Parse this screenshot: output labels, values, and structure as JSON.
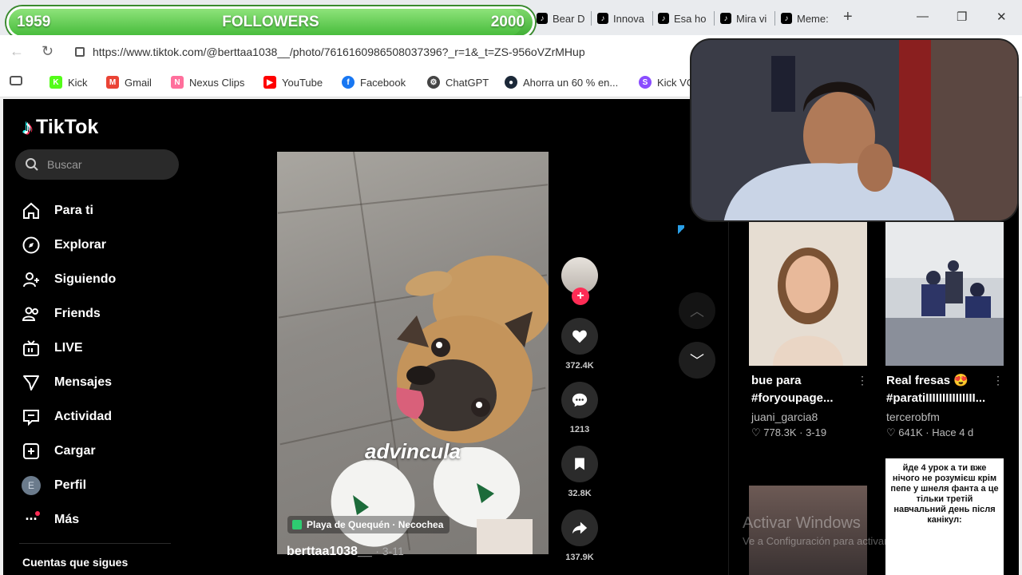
{
  "browser": {
    "tabs": [
      {
        "label": "Bear D"
      },
      {
        "label": "Innova"
      },
      {
        "label": "Esa ho"
      },
      {
        "label": "Mira vi"
      },
      {
        "label": "Meme:"
      }
    ],
    "new_tab": "+",
    "url": "https://www.tiktok.com/@berttaa1038__/photo/7616160986508037396?_r=1&_t=ZS-956oVZrMHup",
    "bookmarks": [
      {
        "label": "Kick",
        "color": "#53fc18"
      },
      {
        "label": "Gmail",
        "color": "#ea4335"
      },
      {
        "label": "Nexus Clips",
        "color": "#ff6f9c"
      },
      {
        "label": "YouTube",
        "color": "#ff0000"
      },
      {
        "label": "Facebook",
        "color": "#1877f2"
      },
      {
        "label": "ChatGPT",
        "color": "#444444"
      },
      {
        "label": "Ahorra un 60 % en...",
        "color": "#1b2838"
      },
      {
        "label": "Kick VO",
        "color": "#8a4dff"
      }
    ]
  },
  "goal": {
    "start": "1959",
    "label": "FOLLOWERS",
    "end": "2000",
    "progress": 0.98
  },
  "sidebar": {
    "brand": "TikTok",
    "search_placeholder": "Buscar",
    "items": [
      {
        "label": "Para ti",
        "icon": "home-icon"
      },
      {
        "label": "Explorar",
        "icon": "compass-icon"
      },
      {
        "label": "Siguiendo",
        "icon": "user-plus-icon"
      },
      {
        "label": "Friends",
        "icon": "friends-icon"
      },
      {
        "label": "LIVE",
        "icon": "live-tv-icon"
      },
      {
        "label": "Mensajes",
        "icon": "send-icon"
      },
      {
        "label": "Actividad",
        "icon": "inbox-icon"
      },
      {
        "label": "Cargar",
        "icon": "plus-square-icon"
      },
      {
        "label": "Perfil",
        "icon": "avatar-icon",
        "avatar_letter": "E"
      },
      {
        "label": "Más",
        "icon": "more-icon"
      }
    ],
    "following_header": "Cuentas que sigues"
  },
  "post": {
    "caption": "advincula",
    "location": "Playa de Quequén · Necochea",
    "author": "berttaa1038__",
    "date": "· 3-11",
    "likes": "372.4K",
    "comments": "1213",
    "saves": "32.8K",
    "shares": "137.9K",
    "follow": "+"
  },
  "related": [
    {
      "title_line1": "bue para",
      "title_line2": "#foryoupage...",
      "user": "juani_garcia8",
      "likes": "778.3K",
      "date": "3-19"
    },
    {
      "title_line1": "Real fresas 😍",
      "title_line2": "#paratiIIIIIIIIIIIIIII...",
      "user": "tercerobfm",
      "likes": "641K",
      "date": "Hace 4 d"
    },
    {
      "thumb_text": "йде 4 урок а ти вже нічого не розумієш крім пепе у шнеля фанта а це тільки третій навчальний день після канікул:"
    }
  ],
  "watermark": {
    "line1": "Activar Windows",
    "line2": "Ve a Configuración para activar Windows."
  }
}
